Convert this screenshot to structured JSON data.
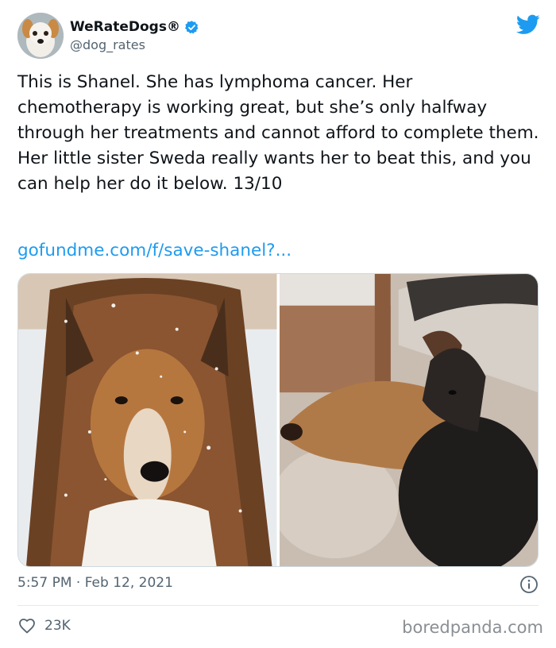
{
  "account": {
    "display_name": "WeRateDogs®",
    "handle": "@dog_rates",
    "verified": true,
    "avatar_icon": "dog-avatar",
    "brand_icon": "twitter-bird-icon"
  },
  "tweet": {
    "text": "This is Shanel. She has lymphoma cancer. Her chemotherapy is working great, but she’s only halfway through her treatments and cannot afford to complete them. Her little sister Sweda really wants her to beat this, and you can help her do it below. 13/10",
    "link": "gofundme.com/f/save-shanel?...",
    "timestamp": "5:57 PM · Feb 12, 2021"
  },
  "engagement": {
    "likes": "23K"
  },
  "watermark": "boredpanda.com",
  "colors": {
    "link": "#1d9bf0",
    "verified": "#1d9bf0",
    "muted_text": "#536471",
    "border": "#cfd9de"
  }
}
